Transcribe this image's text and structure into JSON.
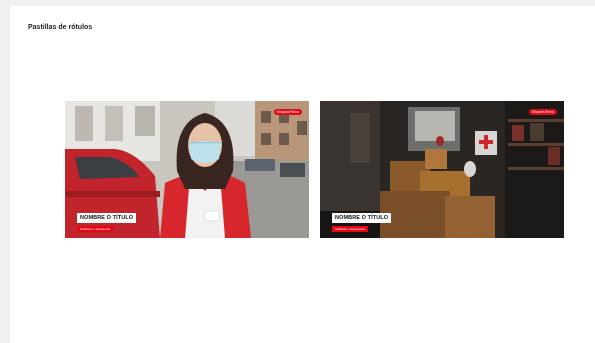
{
  "section": {
    "title": "Pastillas de rótulos"
  },
  "thumbnails": [
    {
      "tag": "Etiqueta/Tema",
      "lower_third": {
        "title": "NOMBRE O TÍTULO",
        "subtitle": "Subtítulo o descripción"
      }
    },
    {
      "tag": "Etiqueta/Tema",
      "lower_third": {
        "title": "NOMBRE O TÍTULO",
        "subtitle": "Subtítulo o descripción"
      }
    }
  ],
  "colors": {
    "brand_red": "#e30613",
    "background": "#ffffff",
    "frame": "#f1f1f1"
  }
}
